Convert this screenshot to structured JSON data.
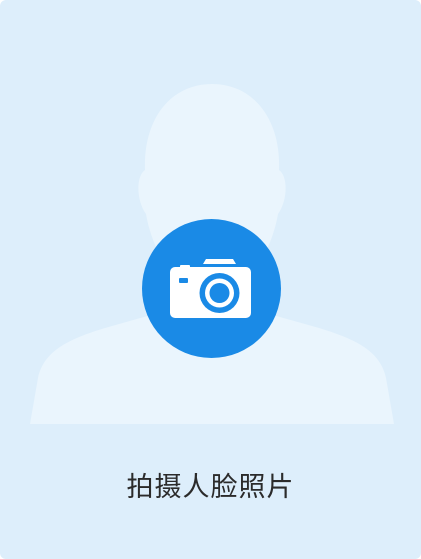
{
  "placeholder": {
    "icon": "person-silhouette",
    "background_color": "#ddeefb",
    "silhouette_color": "#eaf5fd"
  },
  "camera_button": {
    "icon": "camera-icon",
    "color": "#1a8ae6"
  },
  "caption": "拍摄人脸照片"
}
